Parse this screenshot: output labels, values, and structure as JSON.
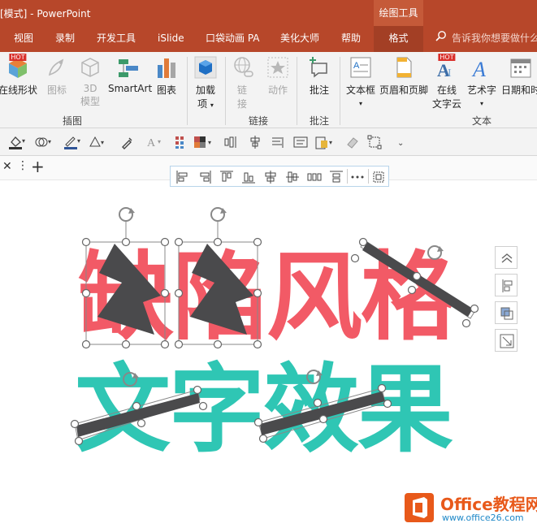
{
  "window": {
    "title": "[模式] - PowerPoint",
    "context_tab_group": "绘图工具"
  },
  "tabs": [
    {
      "label": "视图"
    },
    {
      "label": "录制"
    },
    {
      "label": "开发工具"
    },
    {
      "label": "iSlide"
    },
    {
      "label": "口袋动画 PA"
    },
    {
      "label": "美化大师"
    },
    {
      "label": "帮助"
    },
    {
      "label": "格式"
    }
  ],
  "tell_me": "告诉我你想要做什么",
  "ribbon": {
    "buttons": {
      "online_shapes": "在线形状",
      "icons": "图标",
      "model_3d_line1": "3D",
      "model_3d_line2": "模型",
      "smartart": "SmartArt",
      "chart": "图表",
      "addins_line1": "加载",
      "addins_line2": "项",
      "link_line1": "链",
      "link_line2": "接",
      "action": "动作",
      "comment": "批注",
      "textbox": "文本框",
      "header_footer": "页眉和页脚",
      "online_wordcloud_line1": "在线",
      "online_wordcloud_line2": "文字云",
      "wordart": "艺术字",
      "datetime": "日期和时"
    },
    "badges": {
      "hot": "HOT"
    },
    "groups": {
      "illustrations": "插图",
      "links": "链接",
      "comments": "批注",
      "text": "文本"
    }
  },
  "slide_text": {
    "row1": "缺陷风格",
    "row2": "文字效果"
  },
  "watermark": {
    "line1": "Office教程网",
    "line2": "www.office26.com"
  },
  "colors": {
    "accent": "#b7472a",
    "text_red": "#f25a66",
    "text_teal": "#2fc6b4",
    "shape_dark": "#4a4a4c",
    "watermark_orange": "#e8591a",
    "watermark_blue": "#1e88c8"
  }
}
